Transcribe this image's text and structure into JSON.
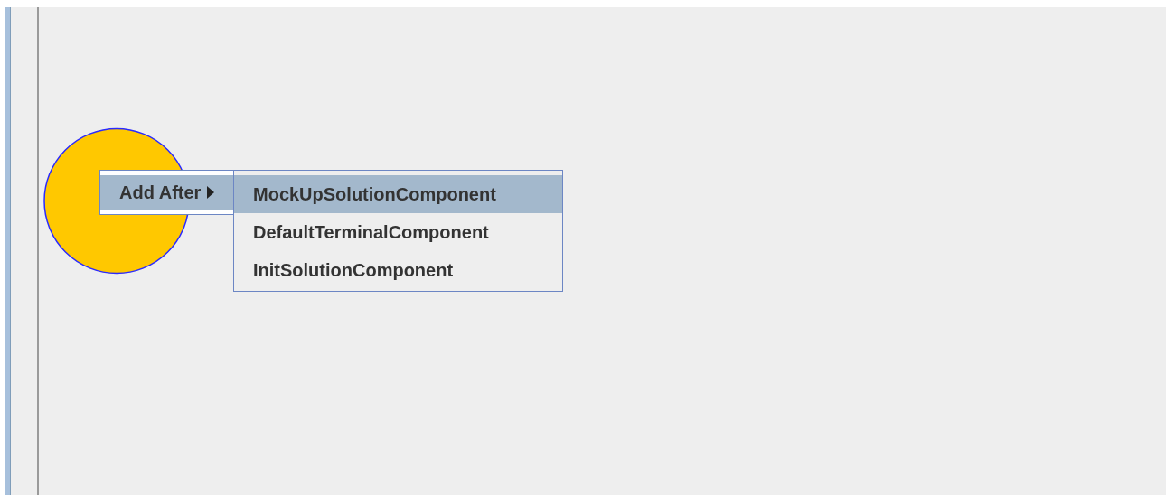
{
  "canvas": {
    "nodes": [
      {
        "kind": "circle",
        "color": "#ffc800"
      }
    ]
  },
  "context_menu": {
    "items": [
      {
        "label": "Add After",
        "selected": true,
        "has_submenu": true
      }
    ]
  },
  "submenu": {
    "items": [
      {
        "label": "MockUpSolutionComponent",
        "selected": true
      },
      {
        "label": "DefaultTerminalComponent",
        "selected": false
      },
      {
        "label": "InitSolutionComponent",
        "selected": false
      }
    ]
  }
}
